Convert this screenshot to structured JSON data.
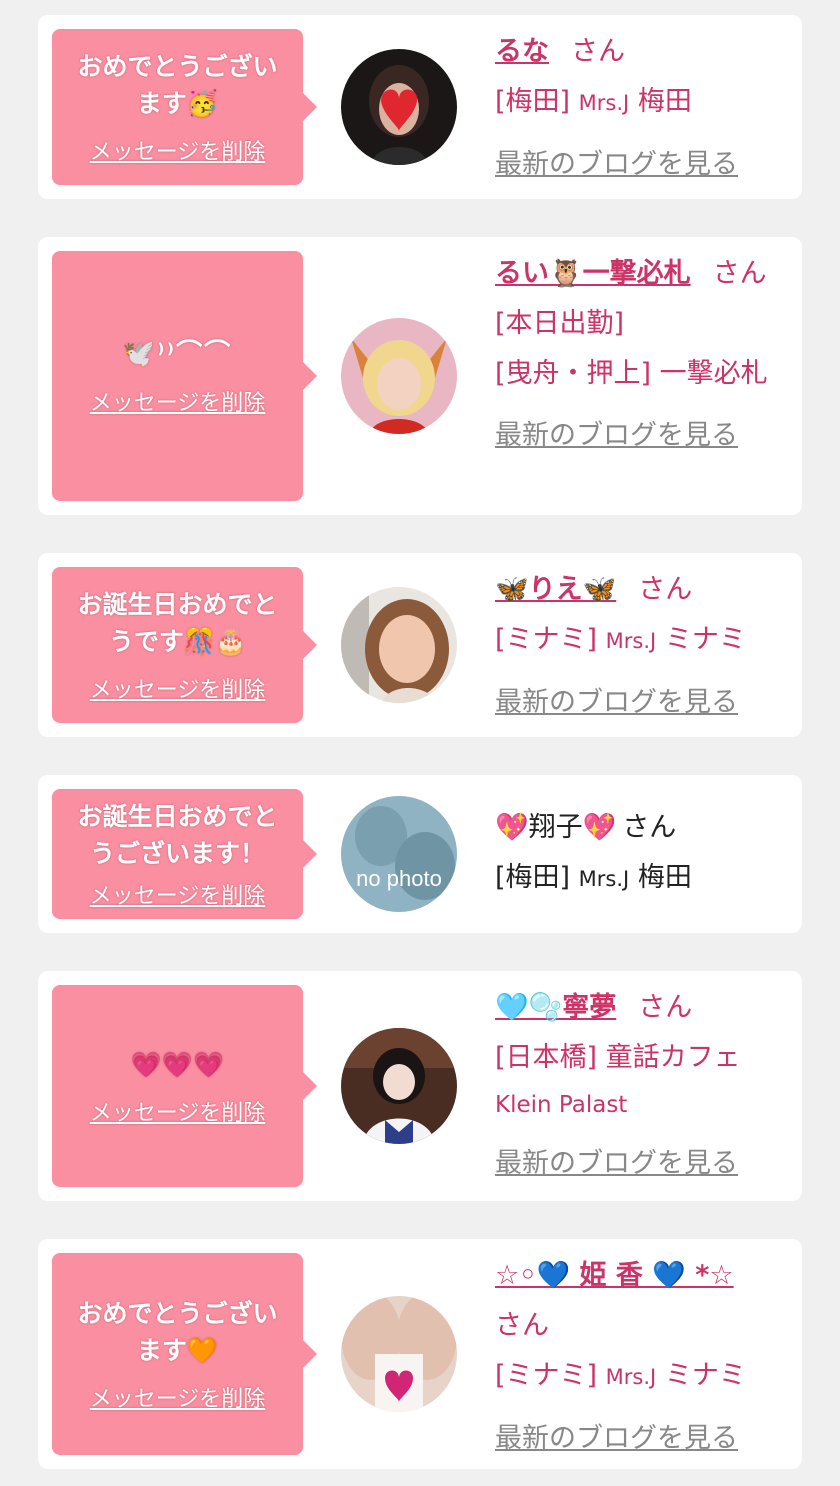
{
  "colors": {
    "accent": "#cc3367",
    "bubble": "#f98fa0",
    "muted": "#888888",
    "bg": "#f0f0f0"
  },
  "delete_label": "メッセージを削除",
  "blog_label": "最新のブログを見る",
  "cards": [
    {
      "message": "おめでとうござい\nます🥳",
      "name": "るな",
      "honorific": "さん",
      "area": "[梅田]",
      "shop_small": "Mrs.J",
      "shop": "梅田"
    },
    {
      "message": "🕊️⁾⁾⌒⌒",
      "name": "るい🦉一撃必札",
      "honorific": "さん",
      "status": "[本日出勤]",
      "area": "[曳舟・押上]",
      "shop": "一撃必札"
    },
    {
      "message": "お誕生日おめでと\nうです🎊🎂",
      "name": "🦋りえ🦋",
      "honorific": "さん",
      "area": "[ミナミ]",
      "shop_small": "Mrs.J",
      "shop": "ミナミ"
    },
    {
      "message": "お誕生日おめでと\nうございます！",
      "name": "💖翔子💖",
      "honorific": "さん",
      "area": "[梅田]",
      "shop_small": "Mrs.J",
      "shop": "梅田",
      "avatar_text": "no photo"
    },
    {
      "message": "💗💗💗",
      "name": "🩵🫧寧夢",
      "honorific": "さん",
      "area": "[日本橋]",
      "shop": "童話カフェ",
      "shop_sub": "Klein Palast"
    },
    {
      "message": "おめでとうござい\nます🧡",
      "name": "☆◦💙 姫 香 💙 *☆",
      "honorific": "さん",
      "area": "[ミナミ]",
      "shop_small": "Mrs.J",
      "shop": "ミナミ"
    }
  ]
}
